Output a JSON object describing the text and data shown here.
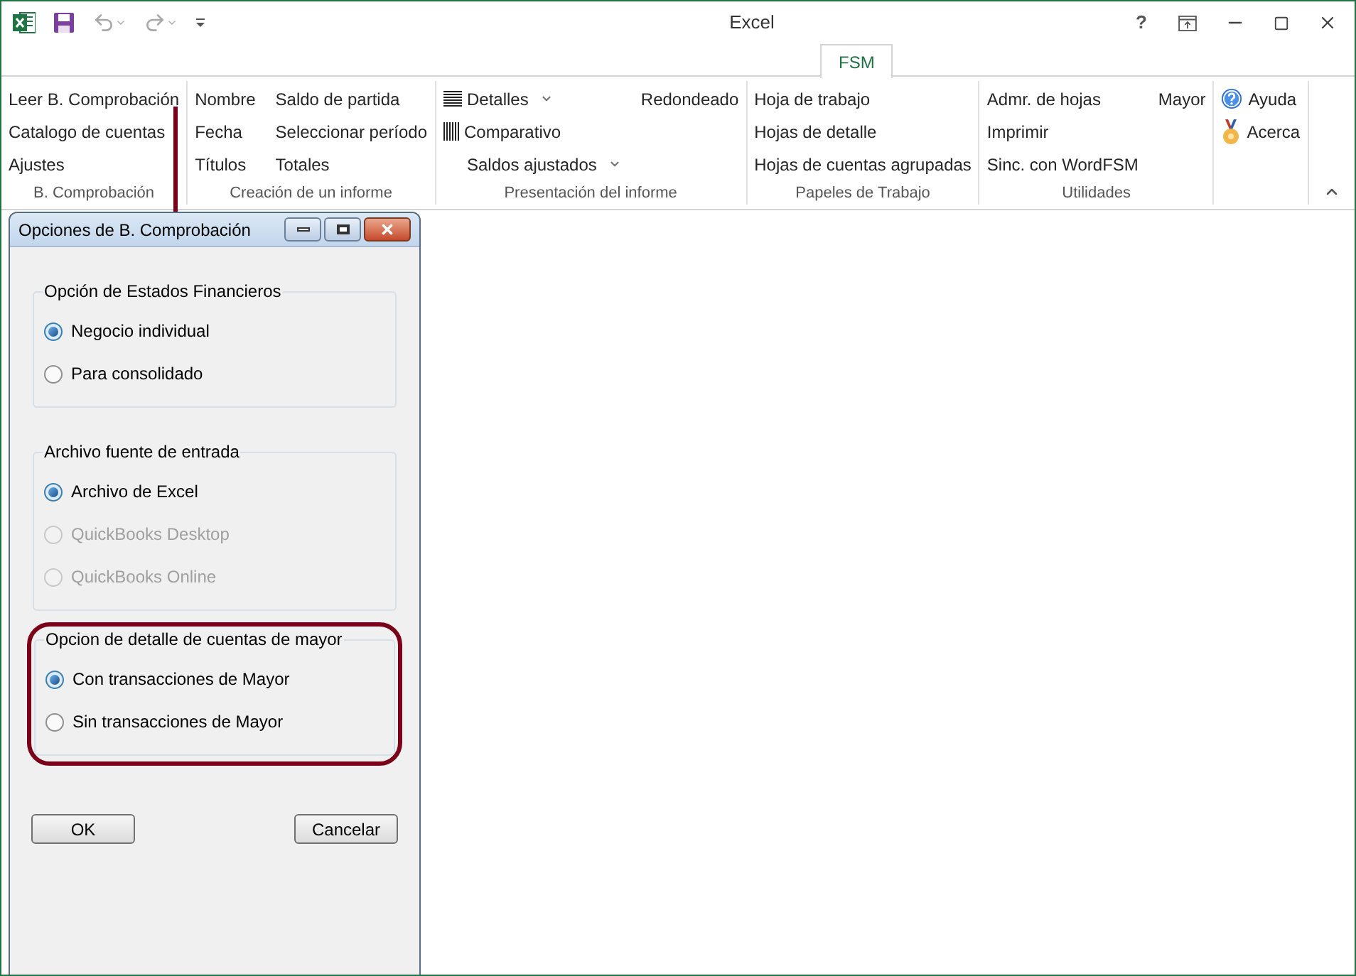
{
  "window": {
    "title": "Excel",
    "help": "?"
  },
  "tabs": [
    {
      "label": "FSM",
      "selected": true
    }
  ],
  "ribbon": {
    "groups": [
      {
        "label": "B. Comprobación",
        "columns": [
          [
            {
              "label": "Leer B. Comprobación",
              "kind": "plain",
              "dropdown": false
            },
            {
              "label": "Catalogo de cuentas",
              "kind": "plain",
              "dropdown": false
            },
            {
              "label": "Ajustes",
              "kind": "plain",
              "dropdown": false
            }
          ]
        ]
      },
      {
        "label": "Creación de un informe",
        "columns": [
          [
            {
              "label": "Nombre",
              "kind": "plain",
              "dropdown": false
            },
            {
              "label": "Fecha",
              "kind": "plain",
              "dropdown": false
            },
            {
              "label": "Títulos",
              "kind": "plain",
              "dropdown": false
            }
          ],
          [
            {
              "label": "Saldo de partida",
              "kind": "plain",
              "dropdown": false
            },
            {
              "label": "Seleccionar período",
              "kind": "plain",
              "dropdown": false
            },
            {
              "label": "Totales",
              "kind": "plain",
              "dropdown": false
            }
          ]
        ]
      },
      {
        "label": "Presentación del informe",
        "columns": [
          [
            {
              "label": "Detalles",
              "kind": "lines",
              "dropdown": true
            },
            {
              "label": "Comparativo",
              "kind": "bars",
              "dropdown": false
            },
            {
              "label": "Saldos ajustados",
              "kind": "plain",
              "dropdown": true
            }
          ],
          [
            {
              "label": "Redondeado",
              "kind": "plain",
              "dropdown": false
            }
          ]
        ]
      },
      {
        "label": "Papeles de Trabajo",
        "columns": [
          [
            {
              "label": "Hoja de trabajo",
              "kind": "plain",
              "dropdown": false
            },
            {
              "label": "Hojas de detalle",
              "kind": "plain",
              "dropdown": false
            },
            {
              "label": "Hojas de cuentas agrupadas",
              "kind": "plain",
              "dropdown": false
            }
          ]
        ]
      },
      {
        "label": "Utilidades",
        "columns": [
          [
            {
              "label": "Admr. de hojas",
              "kind": "plain",
              "dropdown": false
            },
            {
              "label": "Imprimir",
              "kind": "plain",
              "dropdown": false
            },
            {
              "label": "Sinc. con WordFSM",
              "kind": "plain",
              "dropdown": false
            }
          ],
          [
            {
              "label": "Mayor",
              "kind": "plain",
              "dropdown": false
            }
          ]
        ]
      },
      {
        "columns": [
          [
            {
              "label": "Ayuda",
              "kind": "help",
              "dropdown": false
            },
            {
              "label": "Acerca",
              "kind": "award",
              "dropdown": false
            }
          ]
        ]
      }
    ]
  },
  "dialog": {
    "title": "Opciones de B. Comprobación",
    "groups": [
      {
        "legend": "Opción de Estados Financieros",
        "highlighted": false,
        "options": [
          {
            "label": "Negocio individual",
            "selected": true,
            "disabled": false
          },
          {
            "label": "Para consolidado",
            "selected": false,
            "disabled": false
          }
        ]
      },
      {
        "legend": "Archivo fuente de entrada",
        "highlighted": false,
        "options": [
          {
            "label": "Archivo de Excel",
            "selected": true,
            "disabled": false
          },
          {
            "label": "QuickBooks Desktop",
            "selected": false,
            "disabled": true
          },
          {
            "label": "QuickBooks Online",
            "selected": false,
            "disabled": true
          }
        ]
      },
      {
        "legend": "Opcion de detalle de cuentas de mayor",
        "highlighted": true,
        "options": [
          {
            "label": "Con transacciones de Mayor",
            "selected": true,
            "disabled": false
          },
          {
            "label": "Sin transacciones de Mayor",
            "selected": false,
            "disabled": false
          }
        ]
      }
    ],
    "buttons": [
      "OK",
      "Cancelar"
    ]
  }
}
